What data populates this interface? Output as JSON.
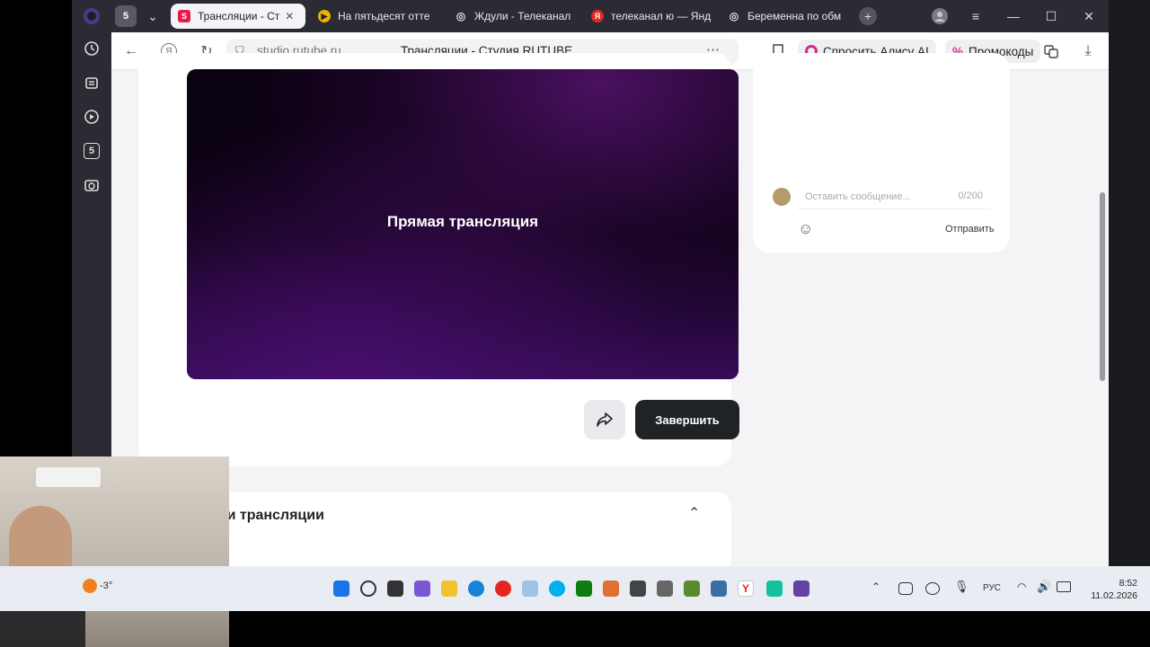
{
  "tabs": [
    {
      "label": "Трансляции - Ст",
      "active": true,
      "icon": "rutube-icon"
    },
    {
      "label": "На пятьдесят отте",
      "active": false,
      "icon": "play-icon"
    },
    {
      "label": "Ждули - Телеканал",
      "active": false,
      "icon": "eye-icon"
    },
    {
      "label": "телеканал ю — Янд",
      "active": false,
      "icon": "yandex-icon"
    },
    {
      "label": "Беременна по обм",
      "active": false,
      "icon": "eye-icon"
    }
  ],
  "sidebar_badge": "5",
  "address": {
    "url": "studio.rutube.ru",
    "page_title": "Трансляции - Студия RUTUBE",
    "alice_label": "Спросить Алису AI",
    "promo_label": "Промокоды"
  },
  "chat": {
    "placeholder": "Оставить сообщение...",
    "counter": "0/200",
    "send_label": "Отправить"
  },
  "player": {
    "title": "Прямая трансляция"
  },
  "actions": {
    "end_label": "Завершить"
  },
  "settings": {
    "title": "Настройки трансляции"
  },
  "taskbar": {
    "weather": "-3°",
    "lang": "РУС",
    "time": "8:52",
    "date": "11.02.2026"
  },
  "colors": {
    "accent": "#e51b4e",
    "button_dark": "#1f2326",
    "support_button": "#1f8a9a"
  }
}
